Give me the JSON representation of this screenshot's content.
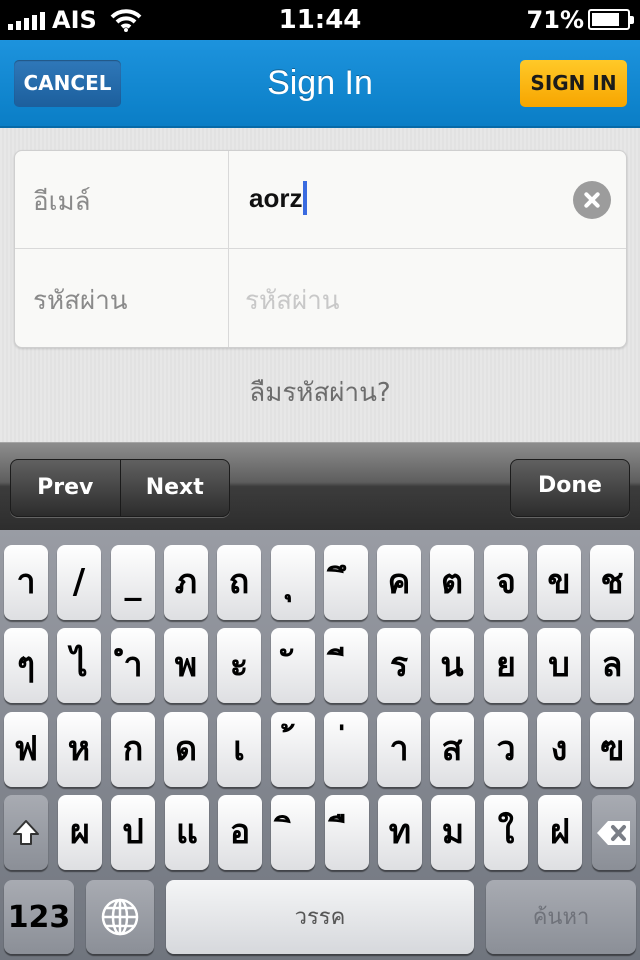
{
  "status_bar": {
    "carrier": "AIS",
    "time": "11:44",
    "battery_percent": "71%",
    "battery_level": 0.71,
    "icons": [
      "signal-icon",
      "wifi-icon",
      "battery-icon"
    ]
  },
  "nav": {
    "title": "Sign In",
    "cancel_label": "CANCEL",
    "signin_label": "SIGN IN",
    "colors": {
      "bar": "#0a7ec6",
      "cancel": "#1c5f9d",
      "signin": "#f7a500"
    }
  },
  "form": {
    "email_label": "อีเมล์",
    "email_value": "aorz",
    "password_label": "รหัสผ่าน",
    "password_placeholder": "รหัสผ่าน",
    "forgot_label": "ลืมรหัสผ่าน?"
  },
  "accessory": {
    "prev_label": "Prev",
    "next_label": "Next",
    "done_label": "Done"
  },
  "keyboard": {
    "rows": [
      [
        "า",
        "/",
        "_",
        "ภ",
        "ถ",
        "ุ",
        "ึ",
        "ค",
        "ต",
        "จ",
        "ข",
        "ช"
      ],
      [
        "ๆ",
        "ไ",
        "ำ",
        "พ",
        "ะ",
        "ั",
        "ี",
        "ร",
        "น",
        "ย",
        "บ",
        "ล"
      ],
      [
        "ฟ",
        "ห",
        "ก",
        "ด",
        "เ",
        "้",
        "่",
        "า",
        "ส",
        "ว",
        "ง",
        "ฃ"
      ],
      [
        "ผ",
        "ป",
        "แ",
        "อ",
        "ิ",
        "ื",
        "ท",
        "ม",
        "ใ",
        "ฝ"
      ]
    ],
    "numbers_label": "123",
    "space_label": "วรรค",
    "search_label": "ค้นหา",
    "icons": [
      "shift-icon",
      "delete-icon",
      "globe-icon"
    ]
  }
}
